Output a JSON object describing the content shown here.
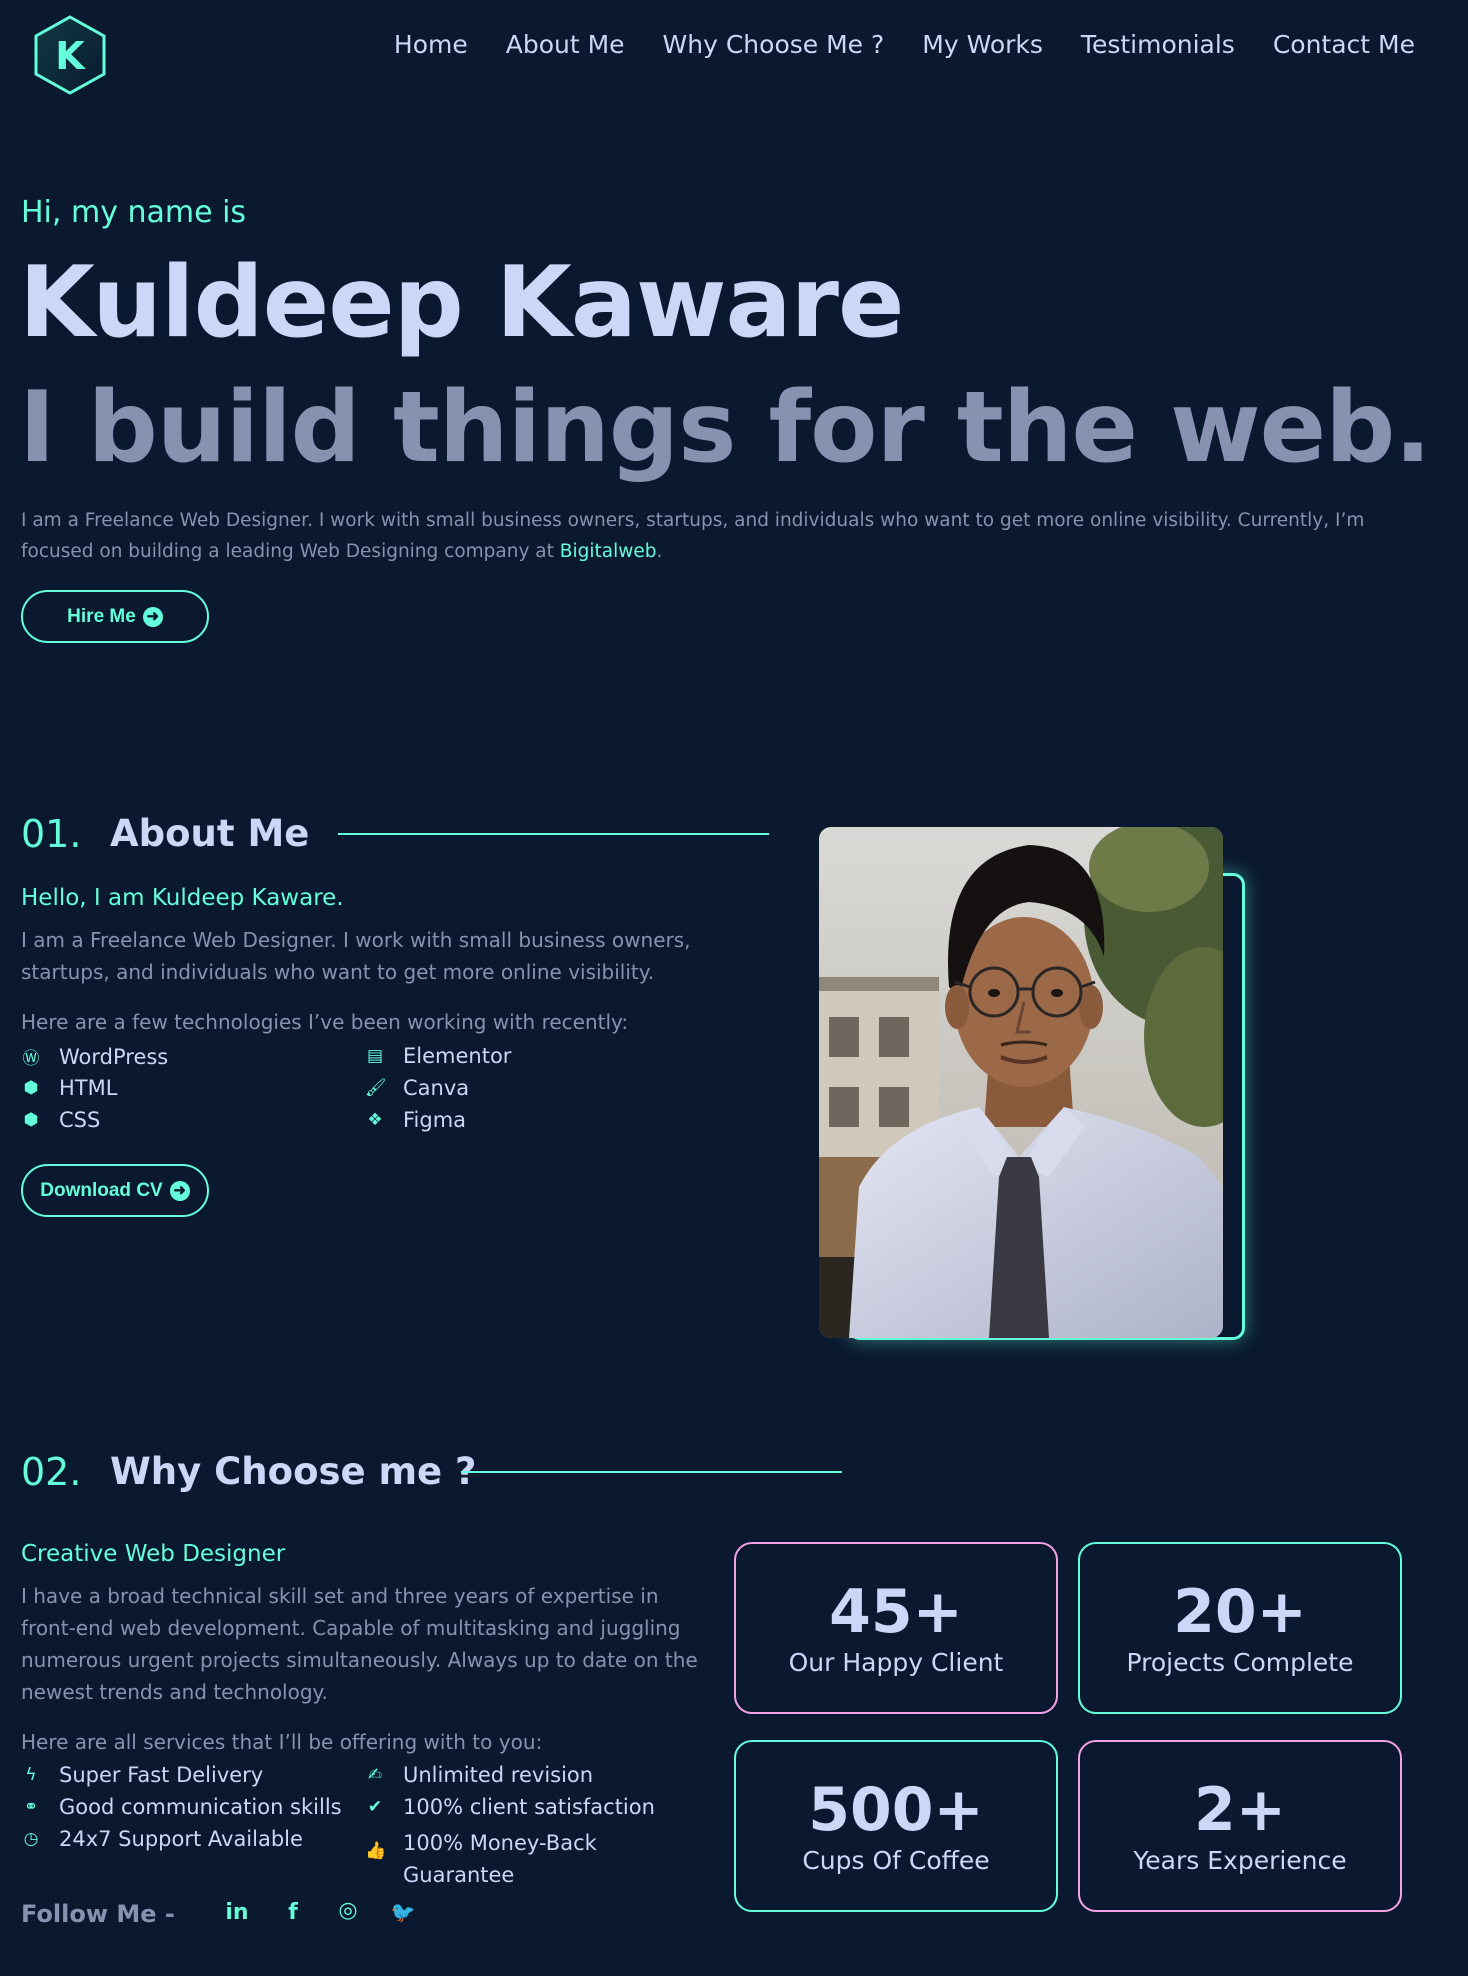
{
  "brand": {
    "logo_letter": "K",
    "accent": "#64ffda",
    "pink_accent": "#f5a3e6",
    "background": "#0a1930"
  },
  "nav": [
    "Home",
    "About Me",
    "Why Choose Me ?",
    "My Works",
    "Testimonials",
    "Contact Me"
  ],
  "hero": {
    "greeting": "Hi, my name is",
    "name": "Kuldeep Kaware",
    "tagline": "I build things for the web.",
    "intro": "I am a Freelance Web Designer. I work with small business owners, startups, and individuals who want to get more online visibility. Currently, I’m focused on building a leading Web Designing company at ",
    "company": "Bigitalweb",
    "intro_end": ".",
    "cta": "Hire Me"
  },
  "about": {
    "number": "01.",
    "title": "About Me",
    "hello": "Hello, I am Kuldeep Kaware.",
    "description": "I am a Freelance Web Designer. I work with small business owners, startups, and individuals who want to get more online visibility.",
    "tech_intro": "Here are a few technologies I’ve been working with recently:",
    "technologies": [
      {
        "label": "WordPress",
        "icon": "wordpress-icon"
      },
      {
        "label": "Elementor",
        "icon": "elementor-icon"
      },
      {
        "label": "HTML",
        "icon": "html5-icon"
      },
      {
        "label": "Canva",
        "icon": "brush-icon"
      },
      {
        "label": "CSS",
        "icon": "css3-icon"
      },
      {
        "label": "Figma",
        "icon": "figma-icon"
      }
    ],
    "cta": "Download CV"
  },
  "why": {
    "number": "02.",
    "title": "Why Choose me ?",
    "subtitle": "Creative Web Designer",
    "description": "I have a broad technical skill set and three years of expertise in front-end web development. Capable of multitasking and juggling numerous urgent projects simultaneously. Always up to date on the newest trends and technology.",
    "services_intro": "Here are all services that  I’ll be offering with to you:",
    "services": [
      {
        "label": "Super Fast Delivery",
        "icon": "bolt-icon"
      },
      {
        "label": "Unlimited revision",
        "icon": "revision-icon"
      },
      {
        "label": "Good communication skills",
        "icon": "handshake-icon"
      },
      {
        "label": "100% client satisfaction",
        "icon": "clipboard-check-icon"
      },
      {
        "label": "24x7 Support Available",
        "icon": "support-clock-icon"
      },
      {
        "label": "100% Money-Back",
        "label2": "Guarantee",
        "icon": "thumbs-up-icon"
      }
    ],
    "stats": [
      {
        "value": "45+",
        "label": "Our Happy Client",
        "border": "#f5a3e6"
      },
      {
        "value": "20+",
        "label": "Projects Complete",
        "border": "#64ffda"
      },
      {
        "value": "500+",
        "label": "Cups Of Coffee",
        "border": "#64ffda"
      },
      {
        "value": "2+",
        "label": "Years Experience",
        "border": "#f5a3e6"
      }
    ],
    "follow": "Follow Me -",
    "social": [
      {
        "name": "linkedin-icon",
        "glyph": "in"
      },
      {
        "name": "facebook-icon",
        "glyph": "f"
      },
      {
        "name": "instagram-icon",
        "glyph": "◎"
      },
      {
        "name": "twitter-icon",
        "glyph": "🐦"
      }
    ]
  }
}
